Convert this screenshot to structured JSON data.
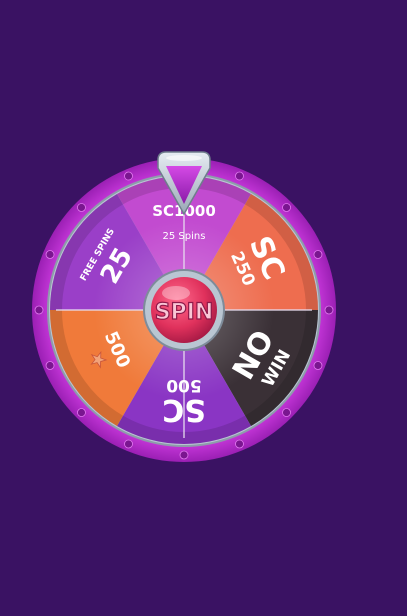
{
  "wheel": {
    "segments": [
      {
        "id": "sc-1000",
        "big": "SC",
        "value": "1000",
        "sub": "25 Spins",
        "color": "#c24bd0"
      },
      {
        "id": "sc-250",
        "big": "SC",
        "value": "250",
        "color": "#ee6d4f"
      },
      {
        "id": "no-win",
        "line1": "NO",
        "line2": "WIN",
        "color": "#3a3036"
      },
      {
        "id": "sc-500-bottom",
        "big": "SC",
        "value": "500",
        "color": "#8a35c4"
      },
      {
        "id": "star-500",
        "value": "500",
        "color": "#f07a3a"
      },
      {
        "id": "free-spins",
        "caption": "FREE SPINS",
        "value": "25",
        "color": "#9a3fc8"
      }
    ],
    "spin_button": {
      "label": "SPIN"
    },
    "colors": {
      "rim": "#c534d8",
      "inner_ring": "#b9c6d2",
      "hub": "#e83a67",
      "background": "#3a1263",
      "pointer": "#b22bd1"
    }
  }
}
